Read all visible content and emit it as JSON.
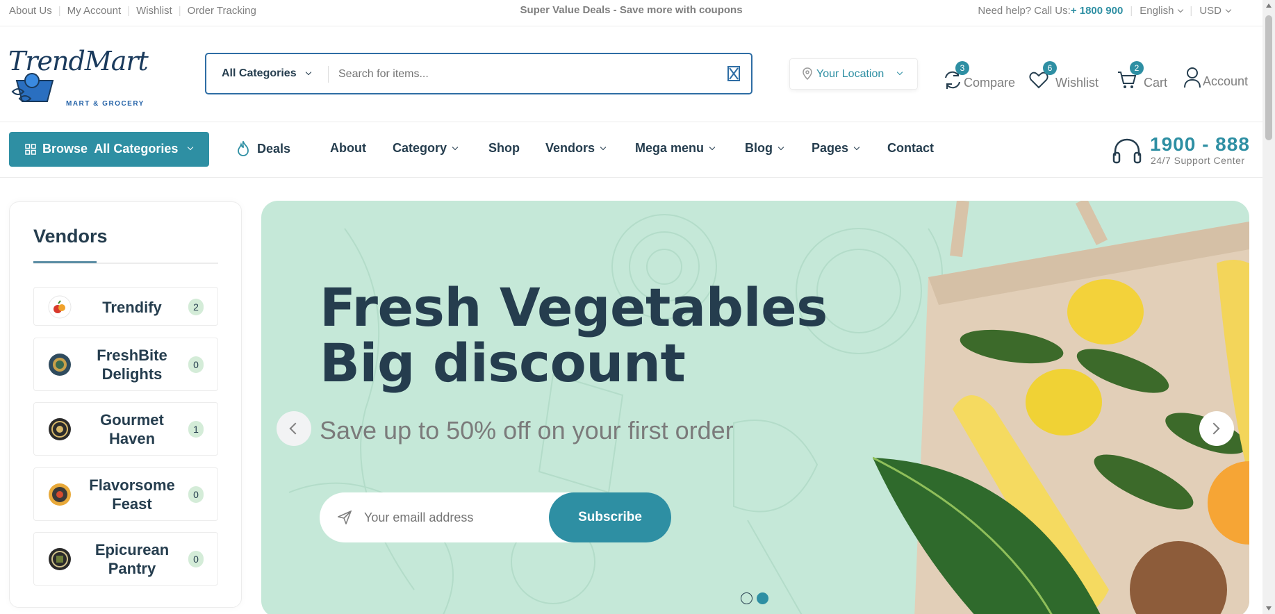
{
  "topbar": {
    "links": [
      "About Us",
      "My Account",
      "Wishlist",
      "Order Tracking"
    ],
    "promo": "Super Value Deals - Save more with coupons",
    "help_text": "Need help? Call Us:",
    "phone": "+ 1800 900",
    "language": "English",
    "currency": "USD"
  },
  "header": {
    "logo_name": "TrendMart",
    "logo_tagline": "MART & GROCERY",
    "search": {
      "category": "All Categories",
      "placeholder": "Search for items..."
    },
    "location": "Your Location",
    "compare": {
      "label": "Compare",
      "count": "3"
    },
    "wishlist": {
      "label": "Wishlist",
      "count": "6"
    },
    "cart": {
      "label": "Cart",
      "count": "2"
    },
    "account": {
      "label": "Account"
    }
  },
  "nav": {
    "browse": "Browse  All Categories",
    "items": [
      "Deals",
      "About",
      "Category",
      "Shop",
      "Vendors",
      "Mega menu",
      "Blog",
      "Pages",
      "Contact"
    ],
    "support_number": "1900 - 888",
    "support_sub": "24/7 Support Center"
  },
  "vendors": {
    "title": "Vendors",
    "items": [
      {
        "name": "Trendify",
        "count": "2"
      },
      {
        "name": "FreshBite Delights",
        "count": "0"
      },
      {
        "name": "Gourmet Haven",
        "count": "1"
      },
      {
        "name": "Flavorsome Feast",
        "count": "0"
      },
      {
        "name": "Epicurean Pantry",
        "count": "0"
      }
    ]
  },
  "hero": {
    "title_line1": "Fresh Vegetables",
    "title_line2": "Big discount",
    "subtitle": "Save up to 50% off on your first order",
    "email_placeholder": "Your emaill address",
    "subscribe": "Subscribe",
    "active_slide": 2,
    "slide_count": 2
  },
  "colors": {
    "accent": "#2e8fa3",
    "heading": "#253d4e",
    "hero_bg": "#c5e8d8",
    "badge_bg": "#d4ecd8"
  }
}
